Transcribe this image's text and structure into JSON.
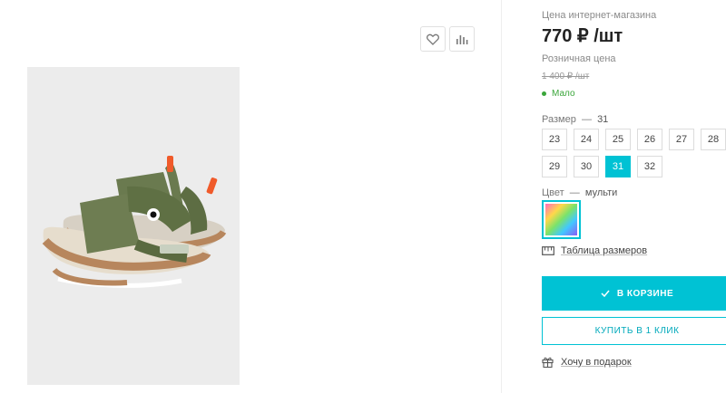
{
  "left": {
    "favorite_icon": "heart-icon",
    "compare_icon": "bar-chart-icon"
  },
  "price": {
    "online_label": "Цена интернет-магазина",
    "online_value": "770 ₽ /шт",
    "retail_label": "Розничная цена",
    "retail_value": "1 400 ₽ /шт",
    "stock": "Мало"
  },
  "size": {
    "label": "Размер",
    "dash": "—",
    "selected": "31",
    "row1": [
      "23",
      "24",
      "25",
      "26",
      "27",
      "28"
    ],
    "row2": [
      "29",
      "30",
      "31",
      "32"
    ]
  },
  "color": {
    "label": "Цвет",
    "dash": "—",
    "selected": "мульти"
  },
  "links": {
    "size_table": "Таблица размеров",
    "gift": "Хочу в подарок"
  },
  "buttons": {
    "cart": "В КОРЗИНЕ",
    "one_click": "КУПИТЬ В 1 КЛИК"
  },
  "colors": {
    "accent": "#00c2d4",
    "stock": "#3aa63a"
  }
}
